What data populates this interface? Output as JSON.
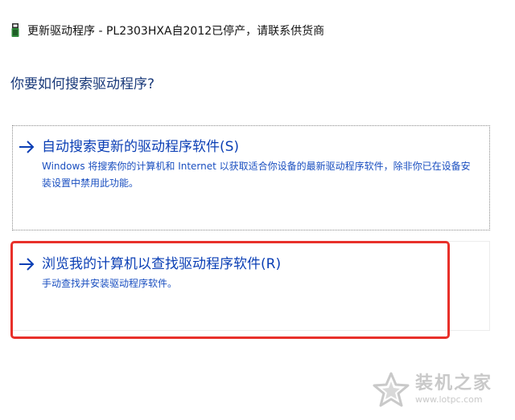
{
  "window": {
    "title": "更新驱动程序 - PL2303HXA自2012已停产，请联系供货商",
    "icon": "usb-device-icon"
  },
  "main": {
    "heading": "你要如何搜索驱动程序?"
  },
  "options": [
    {
      "title": "自动搜索更新的驱动程序软件(S)",
      "description": "Windows 将搜索你的计算机和 Internet 以获取适合你设备的最新驱动程序软件，除非你已在设备安装设置中禁用此功能。",
      "icon": "arrow-right-icon"
    },
    {
      "title": "浏览我的计算机以查找驱动程序软件(R)",
      "description": "手动查找并安装驱动程序软件。",
      "icon": "arrow-right-icon"
    }
  ],
  "watermark": {
    "name": "装机之家",
    "url": "www.lotpc.com"
  },
  "colors": {
    "link": "#0b3fb5",
    "heading": "#1a3a7a",
    "highlight": "#e8302a",
    "watermark": "#c9c9c9"
  }
}
